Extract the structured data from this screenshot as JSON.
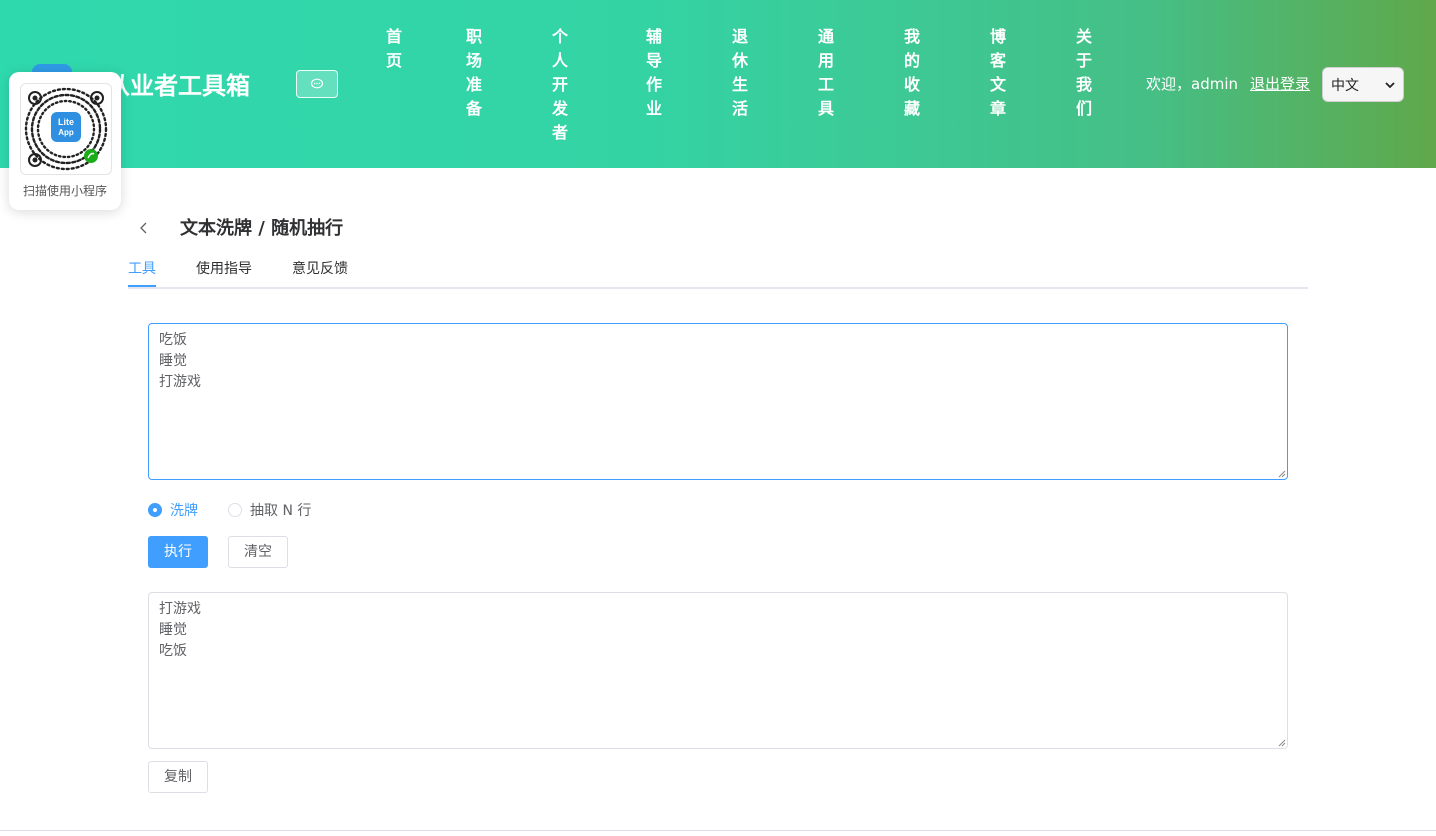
{
  "header": {
    "site_title": "件从业者工具箱",
    "nav": [
      {
        "id": "home",
        "chars": [
          "首",
          "页"
        ]
      },
      {
        "id": "career",
        "chars": [
          "职",
          "场",
          "准",
          "备"
        ]
      },
      {
        "id": "indie-dev",
        "chars": [
          "个",
          "人",
          "开",
          "发",
          "者"
        ]
      },
      {
        "id": "homework",
        "chars": [
          "辅",
          "导",
          "作",
          "业"
        ]
      },
      {
        "id": "retirement",
        "chars": [
          "退",
          "休",
          "生",
          "活"
        ]
      },
      {
        "id": "general-tools",
        "chars": [
          "通",
          "用",
          "工",
          "具"
        ]
      },
      {
        "id": "favorites",
        "chars": [
          "我",
          "的",
          "收",
          "藏"
        ]
      },
      {
        "id": "blog",
        "chars": [
          "博",
          "客",
          "文",
          "章"
        ]
      },
      {
        "id": "about",
        "chars": [
          "关",
          "于",
          "我",
          "们"
        ]
      }
    ],
    "welcome": "欢迎，admin",
    "logout": "退出登录",
    "language": "中文"
  },
  "mini_program": {
    "logo_line1": "Lite",
    "logo_line2": "App",
    "caption": "扫描使用小程序"
  },
  "page": {
    "title": "文本洗牌 / 随机抽行",
    "tabs": [
      "工具",
      "使用指导",
      "意见反馈"
    ],
    "active_tab": 0
  },
  "tool": {
    "input_text": "吃饭\n睡觉\n打游戏",
    "modes": [
      "洗牌",
      "抽取 N 行"
    ],
    "selected_mode": 0,
    "run_label": "执行",
    "clear_label": "清空",
    "output_text": "打游戏\n睡觉\n吃饭",
    "copy_label": "复制"
  },
  "colors": {
    "accent": "#409eff",
    "header_start": "#2fd9ae",
    "header_end": "#60a84a"
  }
}
